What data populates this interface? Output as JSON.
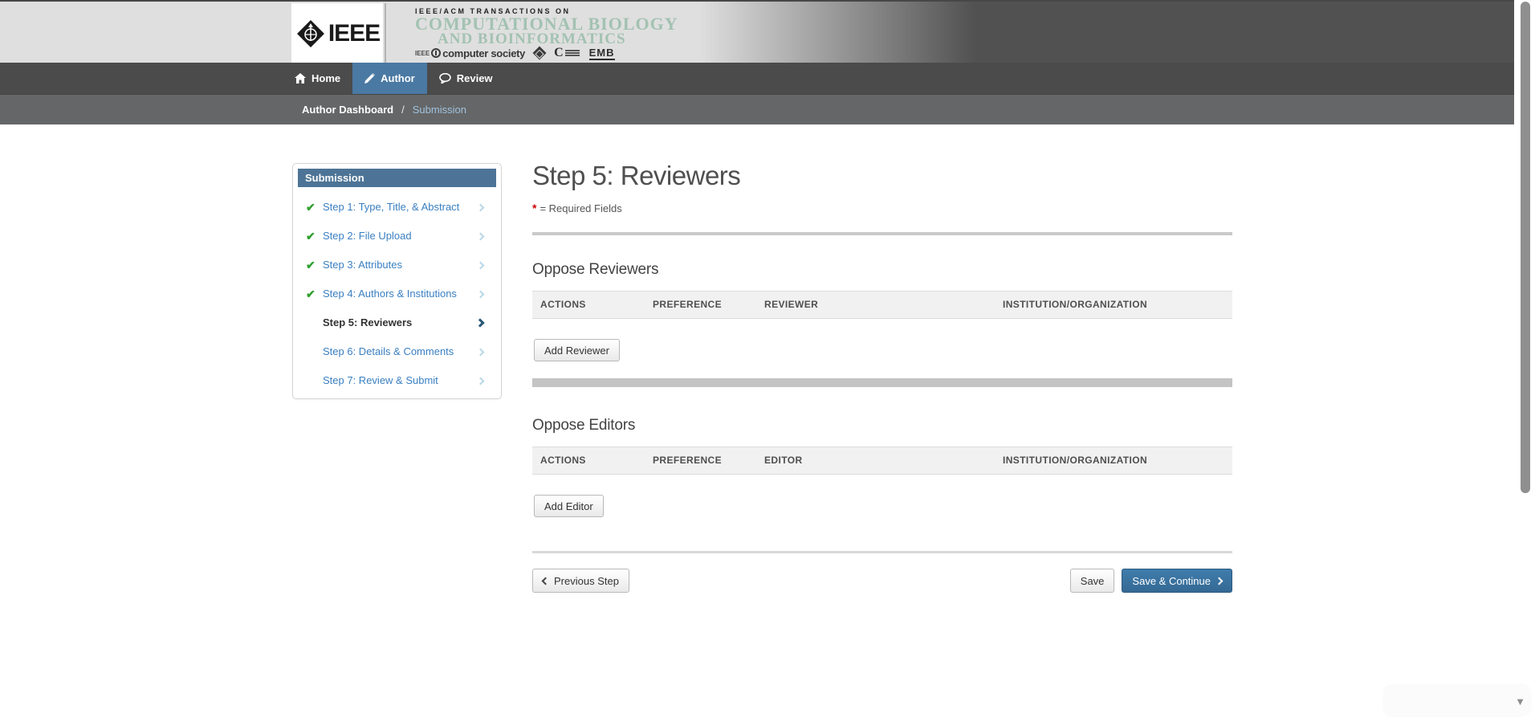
{
  "colors": {
    "nav_active_blue": "#4a79a3",
    "sidebar_header_blue": "#4d7496",
    "link_blue": "#3a7fc1",
    "breadcrumb_link_blue": "#9fc2df",
    "check_green": "#2fa02f",
    "journal_title_green": "#a3c2b2",
    "primary_button_blue": "#36709d",
    "required_red": "#cc0000"
  },
  "header": {
    "logo_text": "IEEE",
    "journal": {
      "line1": "IEEE/ACM TRANSACTIONS ON",
      "line2": "COMPUTATIONAL BIOLOGY",
      "line3": "AND BIOINFORMATICS"
    },
    "societies": {
      "ieee_prefix": "IEEE",
      "computer_society": "computer society",
      "emb": "EMB"
    }
  },
  "nav": {
    "home": "Home",
    "author": "Author",
    "review": "Review"
  },
  "breadcrumb": {
    "dashboard": "Author Dashboard",
    "separator": "/",
    "current": "Submission"
  },
  "sidebar": {
    "title": "Submission",
    "steps": [
      {
        "label": "Step 1: Type, Title, & Abstract",
        "completed": true,
        "active": false
      },
      {
        "label": "Step 2: File Upload",
        "completed": true,
        "active": false
      },
      {
        "label": "Step 3: Attributes",
        "completed": true,
        "active": false
      },
      {
        "label": "Step 4: Authors & Institutions",
        "completed": true,
        "active": false
      },
      {
        "label": "Step 5: Reviewers",
        "completed": false,
        "active": true
      },
      {
        "label": "Step 6: Details & Comments",
        "completed": false,
        "active": false
      },
      {
        "label": "Step 7: Review & Submit",
        "completed": false,
        "active": false
      }
    ]
  },
  "main": {
    "title": "Step 5: Reviewers",
    "required": {
      "asterisk": "*",
      "label": "= Required Fields"
    },
    "oppose_reviewers": {
      "heading": "Oppose Reviewers",
      "columns": [
        "ACTIONS",
        "PREFERENCE",
        "REVIEWER",
        "INSTITUTION/ORGANIZATION"
      ],
      "add_button": "Add Reviewer"
    },
    "oppose_editors": {
      "heading": "Oppose Editors",
      "columns": [
        "ACTIONS",
        "PREFERENCE",
        "EDITOR",
        "INSTITUTION/ORGANIZATION"
      ],
      "add_button": "Add Editor"
    },
    "footer": {
      "previous": "Previous Step",
      "save": "Save",
      "save_continue": "Save & Continue"
    }
  }
}
